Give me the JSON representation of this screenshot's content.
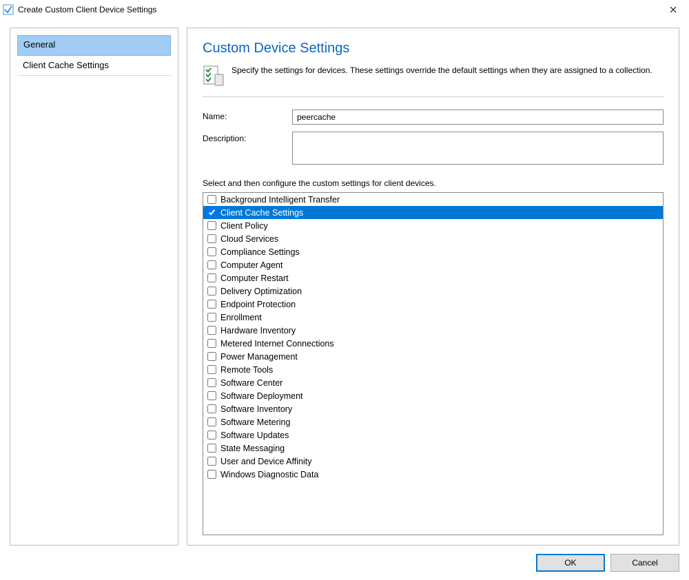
{
  "window": {
    "title": "Create Custom Client Device Settings"
  },
  "sidebar": {
    "items": [
      {
        "label": "General",
        "selected": true
      },
      {
        "label": "Client Cache Settings",
        "selected": false
      }
    ]
  },
  "main": {
    "heading": "Custom Device Settings",
    "intro": "Specify the settings for devices. These settings override the default settings when they are assigned to a collection.",
    "name_label": "Name:",
    "name_value": "peercache",
    "description_label": "Description:",
    "description_value": "",
    "select_label": "Select and then configure the custom settings for client devices.",
    "options": [
      {
        "label": "Background Intelligent Transfer",
        "checked": false,
        "selected": false
      },
      {
        "label": "Client Cache Settings",
        "checked": true,
        "selected": true
      },
      {
        "label": "Client Policy",
        "checked": false,
        "selected": false
      },
      {
        "label": "Cloud Services",
        "checked": false,
        "selected": false
      },
      {
        "label": "Compliance Settings",
        "checked": false,
        "selected": false
      },
      {
        "label": "Computer Agent",
        "checked": false,
        "selected": false
      },
      {
        "label": "Computer Restart",
        "checked": false,
        "selected": false
      },
      {
        "label": "Delivery Optimization",
        "checked": false,
        "selected": false
      },
      {
        "label": "Endpoint Protection",
        "checked": false,
        "selected": false
      },
      {
        "label": "Enrollment",
        "checked": false,
        "selected": false
      },
      {
        "label": "Hardware Inventory",
        "checked": false,
        "selected": false
      },
      {
        "label": "Metered Internet Connections",
        "checked": false,
        "selected": false
      },
      {
        "label": "Power Management",
        "checked": false,
        "selected": false
      },
      {
        "label": "Remote Tools",
        "checked": false,
        "selected": false
      },
      {
        "label": "Software Center",
        "checked": false,
        "selected": false
      },
      {
        "label": "Software Deployment",
        "checked": false,
        "selected": false
      },
      {
        "label": "Software Inventory",
        "checked": false,
        "selected": false
      },
      {
        "label": "Software Metering",
        "checked": false,
        "selected": false
      },
      {
        "label": "Software Updates",
        "checked": false,
        "selected": false
      },
      {
        "label": "State Messaging",
        "checked": false,
        "selected": false
      },
      {
        "label": "User and Device Affinity",
        "checked": false,
        "selected": false
      },
      {
        "label": "Windows Diagnostic Data",
        "checked": false,
        "selected": false
      }
    ]
  },
  "buttons": {
    "ok": "OK",
    "cancel": "Cancel"
  }
}
